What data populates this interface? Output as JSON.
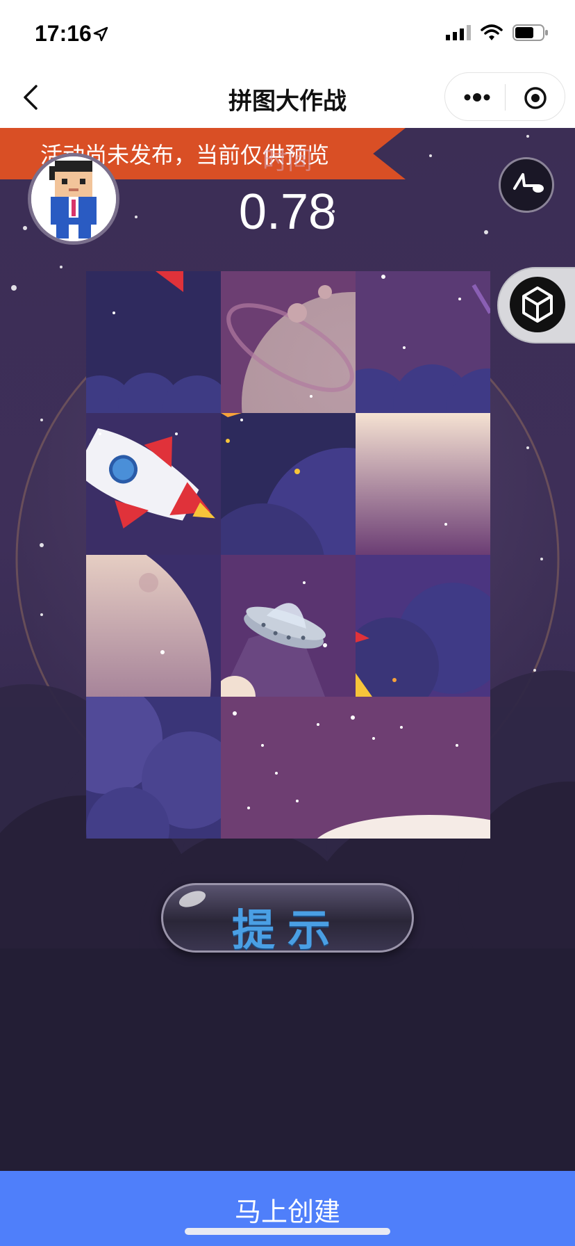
{
  "status_bar": {
    "time": "17:16",
    "icons": [
      "location-arrow-icon",
      "signal-icon",
      "wifi-icon",
      "battery-icon"
    ]
  },
  "nav": {
    "title": "拼图大作战",
    "back_icon": "chevron-left-icon",
    "more_icon": "more-dots-icon",
    "close_icon": "target-circle-icon"
  },
  "game": {
    "banner_text": "活动尚未发布，当前仅供预览",
    "time_label": "时间",
    "timer_value": "0.78",
    "hint_label": "提示",
    "music_icon": "music-icon",
    "unity_icon": "unity-logo-icon",
    "puzzle": {
      "rows": 4,
      "cols": 3,
      "tiles": [
        {
          "row": 0,
          "col": 0,
          "content": "night sky with clouds, rocket fin"
        },
        {
          "row": 0,
          "col": 1,
          "content": "moon top with orbit ring"
        },
        {
          "row": 0,
          "col": 2,
          "content": "purple sky with clouds"
        },
        {
          "row": 1,
          "col": 0,
          "content": "rocket"
        },
        {
          "row": 1,
          "col": 1,
          "content": "dark clouds with stars"
        },
        {
          "row": 1,
          "col": 2,
          "content": "moon glow"
        },
        {
          "row": 2,
          "col": 0,
          "content": "moon edge"
        },
        {
          "row": 2,
          "col": 1,
          "content": "UFO"
        },
        {
          "row": 2,
          "col": 2,
          "content": "clouds with rocket flame"
        },
        {
          "row": 3,
          "col": 0,
          "content": "purple clouds"
        },
        {
          "row": 3,
          "col": 1,
          "content": "starry sky with moon"
        },
        {
          "row": 3,
          "col": 2,
          "content": "starry sky with moon"
        }
      ]
    }
  },
  "footer": {
    "create_label": "马上创建"
  },
  "colors": {
    "banner": "#d94f25",
    "create_button": "#4f7ffa",
    "hint_text": "#4a9fe4"
  }
}
